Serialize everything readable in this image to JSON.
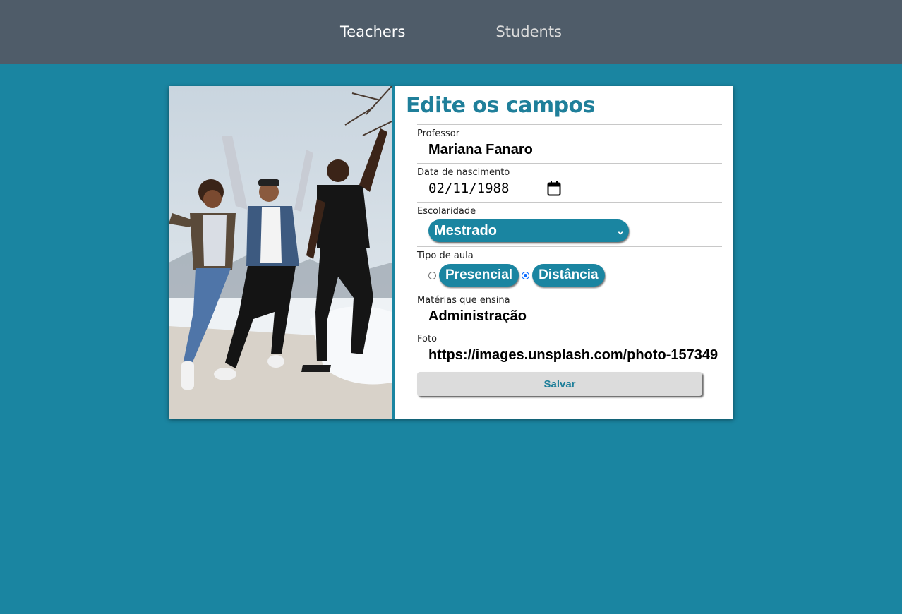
{
  "nav": {
    "teachers_label": "Teachers",
    "students_label": "Students"
  },
  "form": {
    "title": "Edite os campos",
    "professor": {
      "label": "Professor",
      "value": "Mariana Fanaro"
    },
    "birth_date": {
      "label": "Data de nascimento",
      "value": "02/11/1988"
    },
    "education": {
      "label": "Escolaridade",
      "selected": "Mestrado"
    },
    "class_type": {
      "label": "Tipo de aula",
      "options": [
        "Presencial",
        "Distância"
      ],
      "selected": "Distância"
    },
    "subjects": {
      "label": "Matérias que ensina",
      "value": "Administração"
    },
    "photo": {
      "label": "Foto",
      "value": "https://images.unsplash.com/photo-157349"
    },
    "save_label": "Salvar"
  },
  "colors": {
    "accent": "#1a85a1",
    "topbar": "#4f5c69",
    "title": "#1f7f9a"
  }
}
